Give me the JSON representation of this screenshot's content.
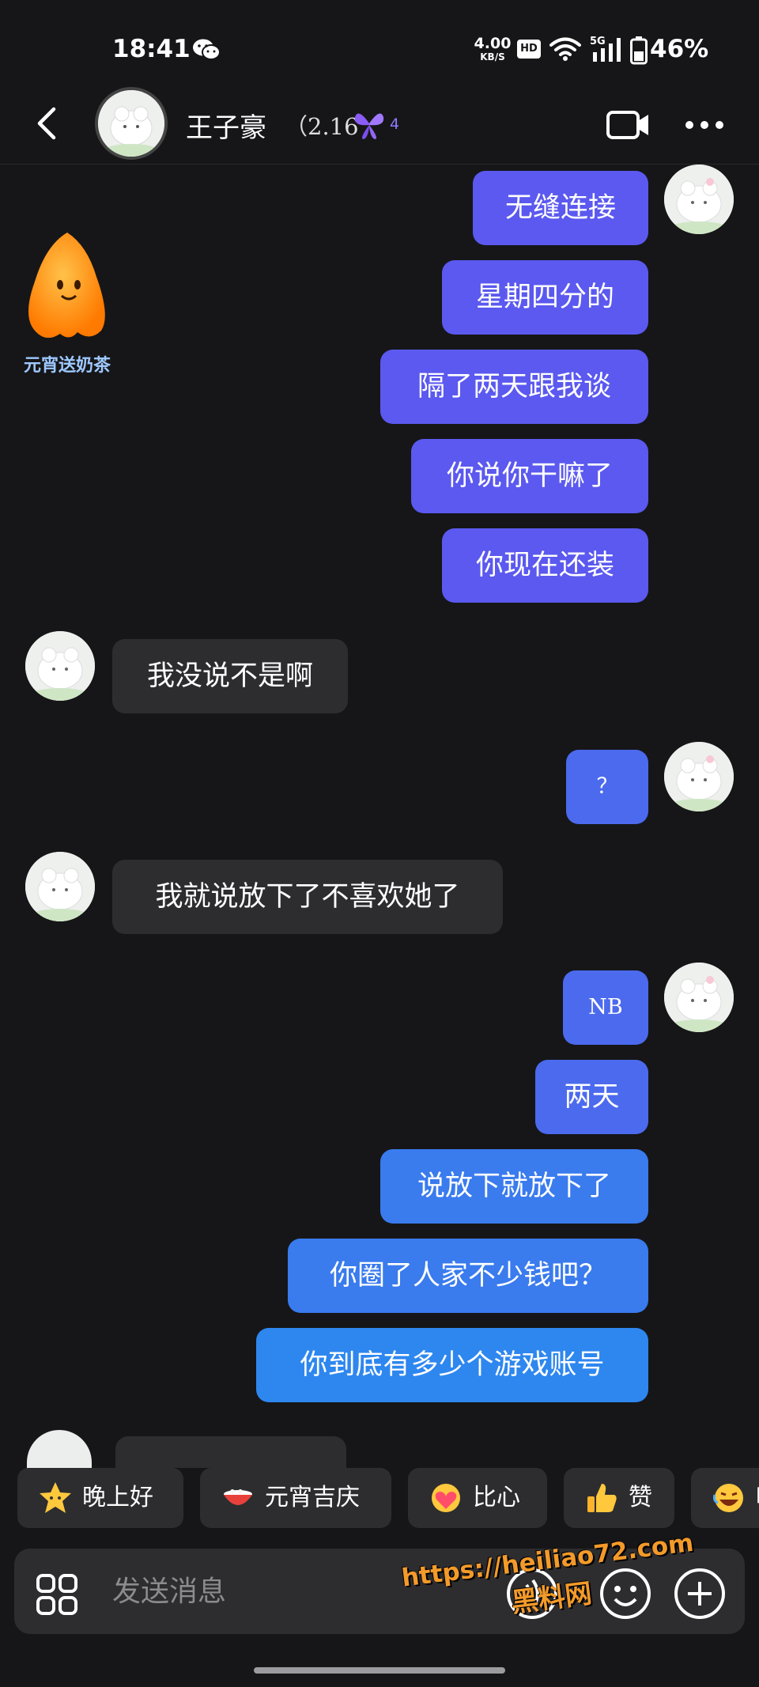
{
  "status_bar": {
    "time": "18:41",
    "net_speed_value": "4.00",
    "net_speed_unit": "KB/S",
    "hd": "HD",
    "network": "5G",
    "battery": "46%"
  },
  "header": {
    "contact_name": "王子豪",
    "badge_text": "（2.16",
    "level": "4"
  },
  "promo": {
    "label": "元宵送奶茶"
  },
  "messages": [
    {
      "dir": "out",
      "text": "无缝连接"
    },
    {
      "dir": "out",
      "text": "星期四分的"
    },
    {
      "dir": "out",
      "text": "隔了两天跟我谈"
    },
    {
      "dir": "out",
      "text": "你说你干嘛了"
    },
    {
      "dir": "out",
      "text": "你现在还装"
    },
    {
      "dir": "in",
      "text": "我没说不是啊"
    },
    {
      "dir": "out",
      "text": "？"
    },
    {
      "dir": "in",
      "text": "我就说放下了不喜欢她了"
    },
    {
      "dir": "out",
      "text": "NB"
    },
    {
      "dir": "out",
      "text": "两天"
    },
    {
      "dir": "out",
      "text": "说放下就放下了"
    },
    {
      "dir": "out",
      "text": "你圈了人家不少钱吧？"
    },
    {
      "dir": "out",
      "text": "你到底有多少个游戏账号"
    }
  ],
  "quick_replies": [
    {
      "label": "晚上好",
      "icon": "star-face-icon"
    },
    {
      "label": "元宵吉庆",
      "icon": "bowl-icon"
    },
    {
      "label": "比心",
      "icon": "heart-hand-icon"
    },
    {
      "label": "赞",
      "icon": "thumbs-up-icon"
    },
    {
      "label": "哈",
      "icon": "laughing-emoji-icon"
    }
  ],
  "input": {
    "placeholder": "发送消息"
  },
  "watermark": {
    "url": "https://heiliao72.com",
    "name": "黑料网"
  },
  "colors": {
    "background": "#161618",
    "outgoing_bubble": "#5b59ef",
    "incoming_bubble": "#2d2d30"
  }
}
